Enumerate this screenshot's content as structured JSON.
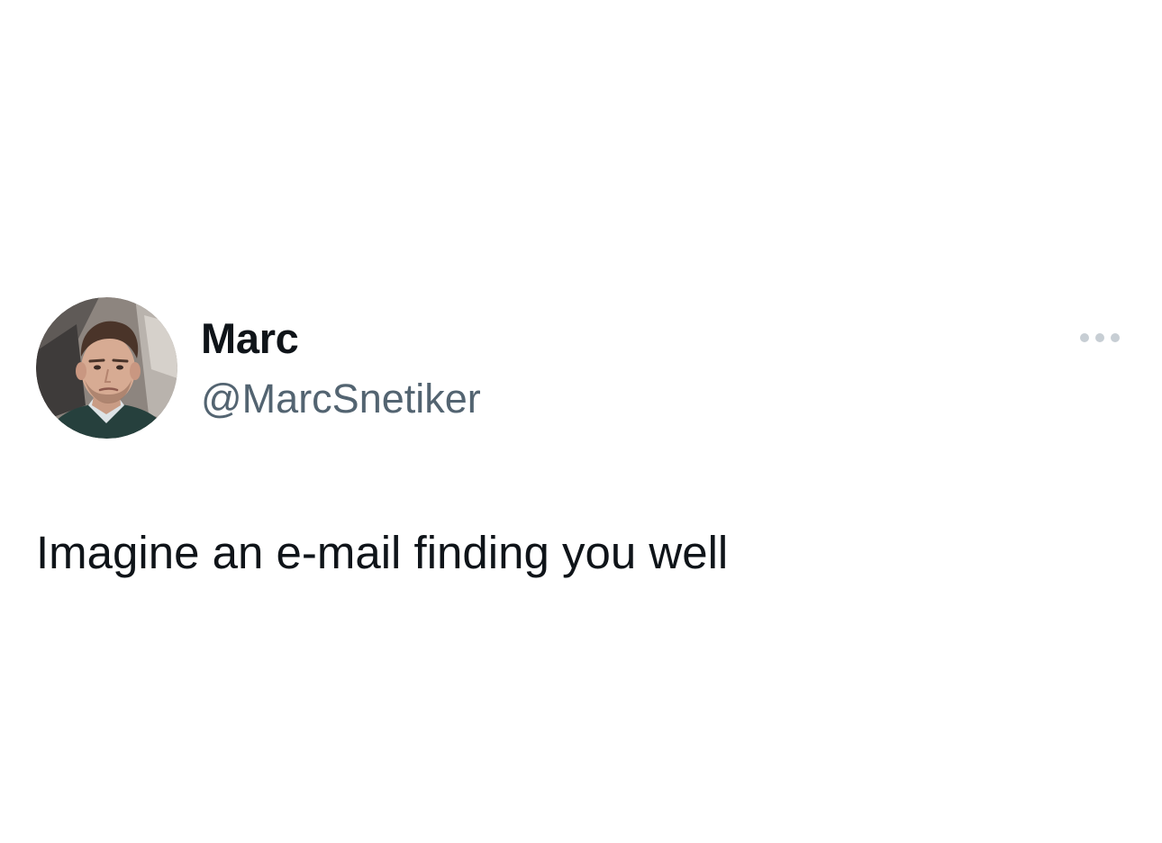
{
  "tweet": {
    "author": {
      "display_name": "Marc",
      "handle": "@MarcSnetiker",
      "avatar_icon": "profile-photo"
    },
    "more_icon": "more-horizontal-icon",
    "text": "Imagine an e-mail finding you well"
  },
  "colors": {
    "background": "#ffffff",
    "primary_text": "#0f1419",
    "secondary_text": "#536471",
    "more_icon": "#c7ced4"
  }
}
